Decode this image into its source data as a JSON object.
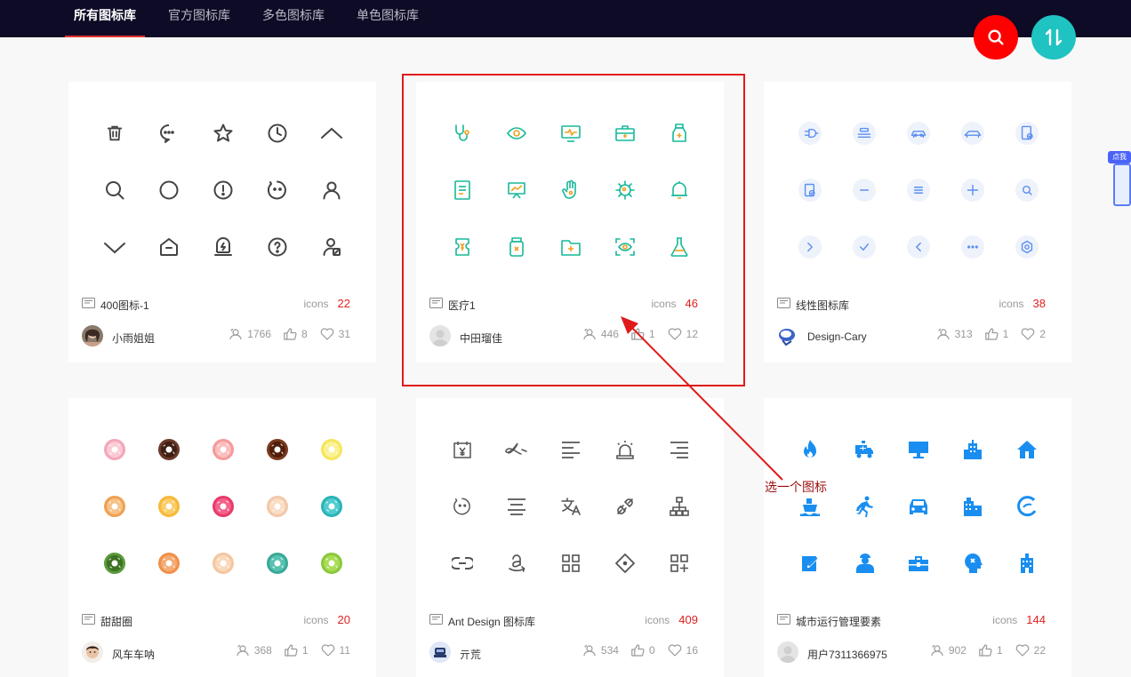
{
  "nav": {
    "tabs": [
      {
        "label": "所有图标库",
        "active": true
      },
      {
        "label": "官方图标库",
        "active": false
      },
      {
        "label": "多色图标库",
        "active": false
      },
      {
        "label": "单色图标库",
        "active": false
      }
    ]
  },
  "colors": {
    "accent_red": "#ff0000",
    "teal": "#1fc3c1",
    "topbar": "#0d0b25",
    "count_red": "#e02020"
  },
  "cards": [
    {
      "name": "400图标-1",
      "icons_label": "icons",
      "icons_count": "22",
      "author": "小雨姐姐",
      "views": "1766",
      "likes": "8",
      "favorites": "31",
      "icon_names": [
        "trash-icon",
        "chat-icon",
        "star-icon",
        "clock-icon",
        "chevron-up-icon",
        "search-icon",
        "circle-icon",
        "alert-icon",
        "emoji-icon",
        "user-icon",
        "chevron-down-icon",
        "home-outline-icon",
        "lightning-box-icon",
        "help-icon",
        "user-settings-icon"
      ]
    },
    {
      "name": "医疗1",
      "icons_label": "icons",
      "icons_count": "46",
      "author": "中田瑠佳",
      "views": "446",
      "likes": "1",
      "favorites": "12",
      "icon_names": [
        "stethoscope-icon",
        "eye-icon",
        "monitor-ecg-icon",
        "medical-kit-icon",
        "medicine-bottle-icon",
        "medical-record-icon",
        "presentation-chart-icon",
        "hand-icon",
        "virus-icon",
        "bell-icon",
        "medical-ticket-icon",
        "pill-bottle-icon",
        "medical-folder-icon",
        "eye-scan-icon",
        "flask-icon"
      ]
    },
    {
      "name": "线性图标库",
      "icons_label": "icons",
      "icons_count": "38",
      "author": "Design-Cary",
      "views": "313",
      "likes": "1",
      "favorites": "2",
      "icon_names": [
        "plug-icon",
        "stack-icon",
        "car-icon",
        "car-side-icon",
        "document-check-icon",
        "file-check-icon",
        "minus-icon",
        "list-icon",
        "plus-icon",
        "search-icon",
        "chevron-right-icon",
        "check-icon",
        "chevron-left-icon",
        "more-icon",
        "settings-icon"
      ]
    },
    {
      "name": "甜甜圈",
      "icons_label": "icons",
      "icons_count": "20",
      "author": "风车车呐",
      "views": "368",
      "likes": "1",
      "favorites": "11",
      "donut_colors": [
        "#f3a6b8",
        "#6b3a2a",
        "#f59a9a",
        "#7a3a20",
        "#f6e65a",
        "#f0a050",
        "#f7b83a",
        "#e83a6a",
        "#f2c7a8",
        "#2bb3b8",
        "#5a9a3a",
        "#f0904a",
        "#f4c6a0",
        "#3aa896",
        "#8ac83a"
      ],
      "donut_icing": [
        "#fbd0da",
        "#3a1a10",
        "#fbc4c4",
        "#4a1a08",
        "#fcf29a",
        "#f7c890",
        "#fad070",
        "#f66a92",
        "#fae0c8",
        "#58d0d2",
        "#3a6a20",
        "#f6b07a",
        "#f9dcc0",
        "#5cc8b6",
        "#aee05a"
      ]
    },
    {
      "name": "Ant Design 图标库",
      "icons_label": "icons",
      "icons_count": "409",
      "author": "亓荒",
      "views": "534",
      "likes": "0",
      "favorites": "16",
      "icon_names": [
        "calendar-yen-icon",
        "alipay-icon",
        "align-left-icon",
        "alert-light-icon",
        "align-right-icon",
        "emoji-icon",
        "align-center-icon",
        "translate-icon",
        "api-icon",
        "apartment-icon",
        "link-icon",
        "amazon-icon",
        "appstore-icon",
        "aim-icon",
        "appstore-add-icon"
      ]
    },
    {
      "name": "城市运行管理要素",
      "icons_label": "icons",
      "icons_count": "144",
      "author": "用户7311366975",
      "views": "902",
      "likes": "1",
      "favorites": "22",
      "icon_names": [
        "fire-icon",
        "ambulance-icon",
        "monitor-icon",
        "building-icon",
        "home-icon",
        "ship-icon",
        "runner-icon",
        "car-icon",
        "office-icon",
        "eco-logo-icon",
        "edit-box-icon",
        "worker-icon",
        "toolbox-icon",
        "head-gear-icon",
        "tower-icon"
      ]
    }
  ],
  "annotation": {
    "text": "选一个图标"
  },
  "side_widget": {
    "label": "点我"
  }
}
